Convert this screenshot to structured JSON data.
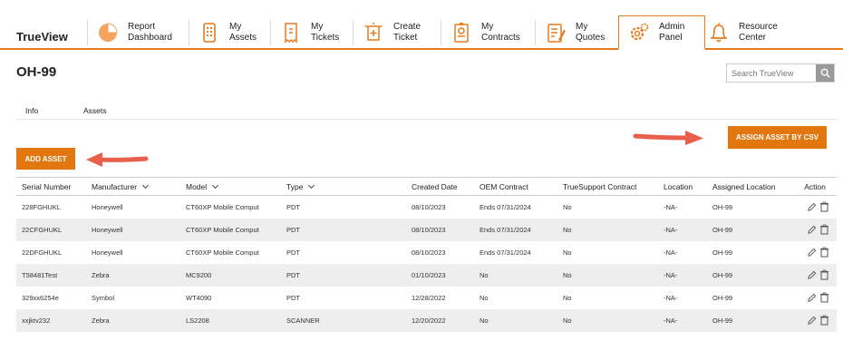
{
  "brand": "TrueView",
  "nav": [
    {
      "line1": "Report",
      "line2": "Dashboard",
      "icon": "pie-chart-icon"
    },
    {
      "line1": "My",
      "line2": "Assets",
      "icon": "device-icon"
    },
    {
      "line1": "My",
      "line2": "Tickets",
      "icon": "ticket-icon"
    },
    {
      "line1": "Create",
      "line2": "Ticket",
      "icon": "create-ticket-icon"
    },
    {
      "line1": "My",
      "line2": "Contracts",
      "icon": "contract-icon"
    },
    {
      "line1": "My",
      "line2": "Quotes",
      "icon": "quote-icon"
    },
    {
      "line1": "Admin",
      "line2": "Panel",
      "icon": "gear-icon"
    },
    {
      "line1": "Resource",
      "line2": "Center",
      "icon": "bell-icon"
    }
  ],
  "page_title": "OH-99",
  "search": {
    "placeholder": "Search TrueView"
  },
  "tabs": {
    "info": "Info",
    "assets": "Assets"
  },
  "buttons": {
    "assign_csv": "ASSIGN ASSET BY CSV",
    "add_asset": "ADD ASSET"
  },
  "table": {
    "headers": [
      "Serial Number",
      "Manufacturer",
      "Model",
      "Type",
      "Created Date",
      "OEM Contract",
      "TrueSupport Contract",
      "Location",
      "Assigned Location",
      "Action"
    ],
    "rows": [
      [
        "228FGHUKL",
        "Honeywell",
        "CT60XP Mobile Comput",
        "PDT",
        "08/10/2023",
        "Ends 07/31/2024",
        "No",
        "-NA-",
        "OH-99"
      ],
      [
        "22CFGHUKL",
        "Honeywell",
        "CT60XP Mobile Comput",
        "PDT",
        "08/10/2023",
        "Ends 07/31/2024",
        "No",
        "-NA-",
        "OH-99"
      ],
      [
        "22DFGHUKL",
        "Honeywell",
        "CT60XP Mobile Comput",
        "PDT",
        "08/10/2023",
        "Ends 07/31/2024",
        "No",
        "-NA-",
        "OH-99"
      ],
      [
        "T58481Test",
        "Zebra",
        "MC9200",
        "PDT",
        "01/10/2023",
        "No",
        "No",
        "-NA-",
        "OH-99"
      ],
      [
        "329xx6254e",
        "Symbol",
        "WT4090",
        "PDT",
        "12/28/2022",
        "No",
        "No",
        "-NA-",
        "OH-99"
      ],
      [
        "xxjktv232",
        "Zebra",
        "LS2208",
        "SCANNER",
        "12/20/2022",
        "No",
        "No",
        "-NA-",
        "OH-99"
      ]
    ]
  },
  "colors": {
    "accent": "#e2760f",
    "arrow": "#e8604c"
  }
}
